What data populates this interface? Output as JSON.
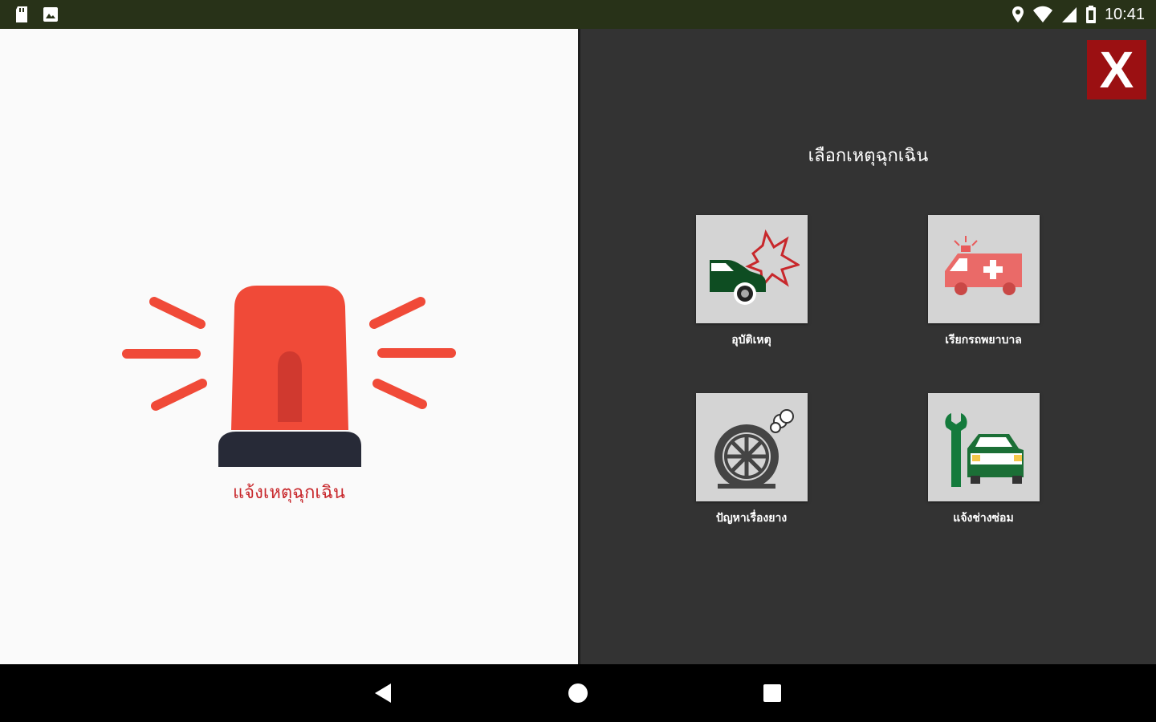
{
  "status_bar": {
    "time": "10:41",
    "icons_left": [
      "sd-card-icon",
      "photo-icon"
    ],
    "icons_right": [
      "location-icon",
      "wifi-icon",
      "signal-icon",
      "battery-icon"
    ]
  },
  "left_panel": {
    "siren_icon": "siren-icon",
    "siren_label": "แจ้งเหตุฉุกเฉิน"
  },
  "right_panel": {
    "close_label": "X",
    "title": "เลือกเหตุฉุกเฉิน",
    "tiles": [
      {
        "label": "อุบัติเหตุ",
        "icon": "car-crash-icon"
      },
      {
        "label": "เรียกรถพยาบาล",
        "icon": "ambulance-icon"
      },
      {
        "label": "ปัญหาเรื่องยาง",
        "icon": "tire-icon"
      },
      {
        "label": "แจ้งช่างซ่อม",
        "icon": "repair-car-icon"
      }
    ]
  },
  "colors": {
    "status_bar": "#283218",
    "siren_red": "#f04a38",
    "label_red": "#c8282c",
    "close_bg": "#9b1012",
    "panel_dark": "#333333",
    "tile_bg": "#d4d4d4",
    "car_green": "#0e4d22"
  },
  "nav_bar": {
    "buttons": [
      "back-icon",
      "home-icon",
      "recents-icon"
    ]
  }
}
